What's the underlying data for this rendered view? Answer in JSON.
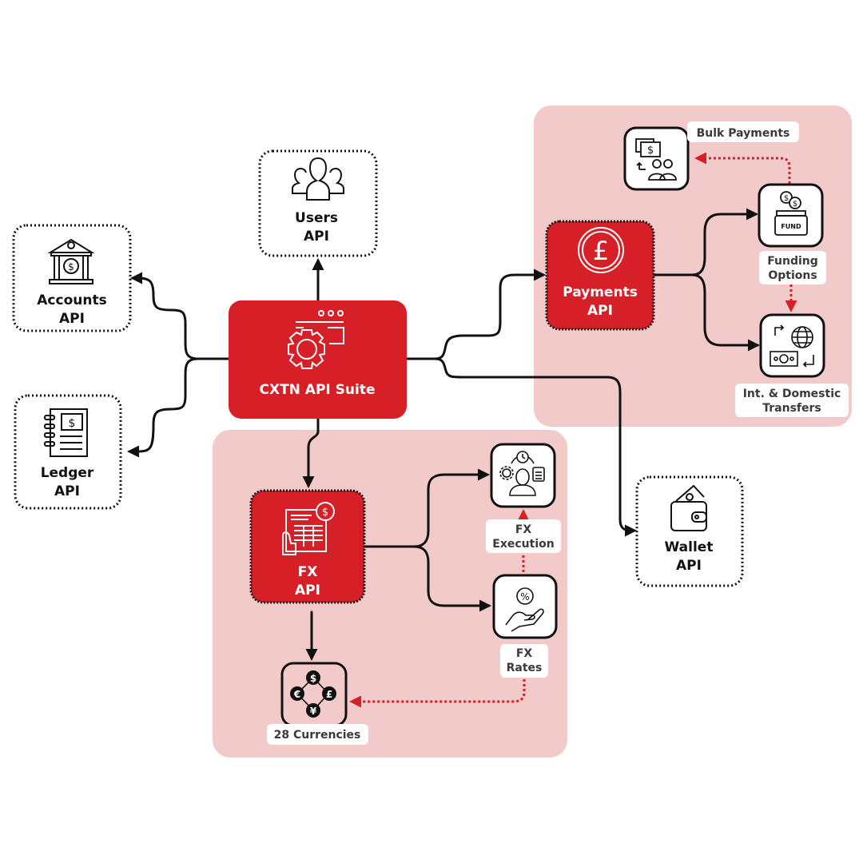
{
  "colors": {
    "brand_red": "#d71f27",
    "group_pink": "#f3caca",
    "line": "#111111",
    "dotted_arrow": "#d71f27",
    "label_bg": "#ffffff",
    "label_text": "#3a3a3a"
  },
  "hub": {
    "title": "CXTN API Suite",
    "icon": "settings-window-icon"
  },
  "apis": {
    "users": {
      "line1": "Users",
      "line2": "API",
      "icon": "users-icon"
    },
    "accounts": {
      "line1": "Accounts",
      "line2": "API",
      "icon": "bank-icon"
    },
    "ledger": {
      "line1": "Ledger",
      "line2": "API",
      "icon": "ledger-notebook-icon"
    },
    "wallet": {
      "line1": "Wallet",
      "line2": "API",
      "icon": "wallet-icon"
    },
    "payments": {
      "line1": "Payments",
      "line2": "API",
      "icon": "pound-coin-icon"
    },
    "fx": {
      "line1": "FX",
      "line2": "API",
      "icon": "invoice-dollar-icon"
    }
  },
  "payments_group": {
    "bulk_payments": {
      "label": "Bulk Payments",
      "icon": "bulk-payments-icon"
    },
    "funding_options": {
      "line1": "Funding",
      "line2": "Options",
      "icon": "fund-jar-icon",
      "jar_text": "FUND"
    },
    "transfers": {
      "line1": "Int. & Domestic",
      "line2": "Transfers",
      "icon": "global-transfer-icon"
    }
  },
  "fx_group": {
    "execution": {
      "line1": "FX",
      "line2": "Execution",
      "icon": "execution-person-icon"
    },
    "rates": {
      "line1": "FX",
      "line2": "Rates",
      "icon": "percent-hand-icon"
    },
    "currencies": {
      "label": "28 Currencies",
      "icon": "currency-exchange-icon",
      "symbols": [
        "$",
        "€",
        "£",
        "¥"
      ]
    }
  }
}
